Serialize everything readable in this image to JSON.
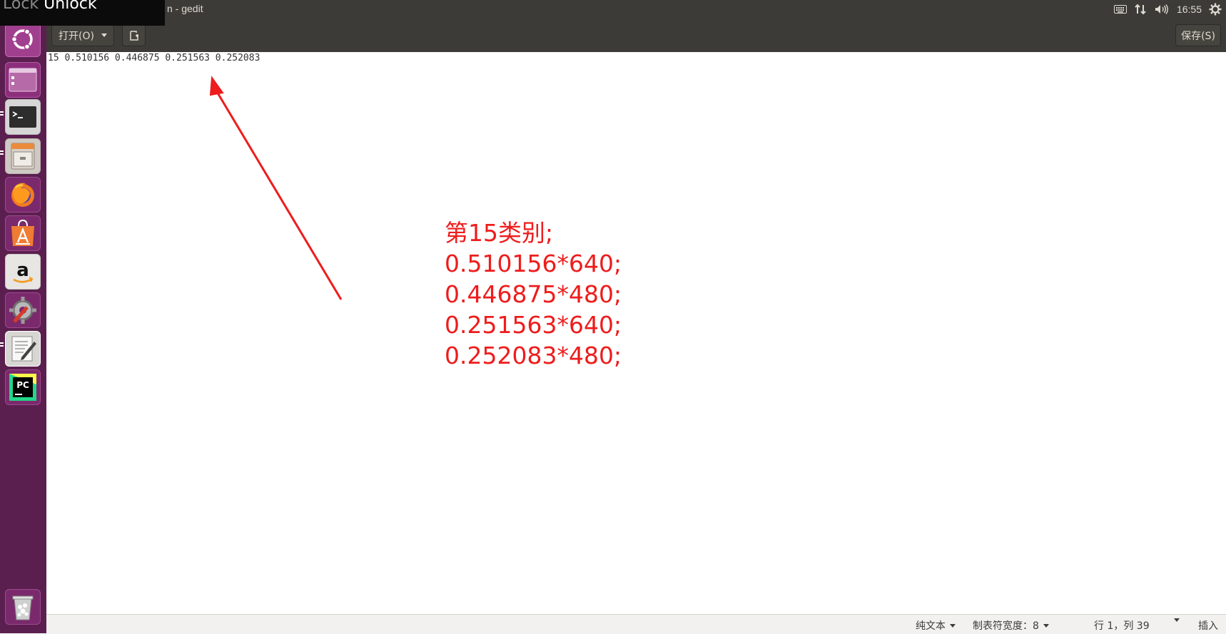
{
  "topbar": {
    "lock_text_a": "Lock",
    "lock_text_b": "Unlock",
    "window_title": "n - gedit",
    "time": "16:55"
  },
  "launcher": {
    "items": [
      {
        "name": "ubuntu-dash"
      },
      {
        "name": "workspace-switcher"
      },
      {
        "name": "terminal"
      },
      {
        "name": "files"
      },
      {
        "name": "firefox"
      },
      {
        "name": "ubuntu-software"
      },
      {
        "name": "amazon"
      },
      {
        "name": "system-settings"
      },
      {
        "name": "text-editor"
      },
      {
        "name": "pycharm",
        "label": "PC"
      },
      {
        "name": "trash"
      }
    ]
  },
  "headerbar": {
    "open_label": "打开(O)",
    "save_label": "保存(S)"
  },
  "editor": {
    "content": "15 0.510156 0.446875 0.251563 0.252083"
  },
  "annotation": {
    "lines": [
      "第15类别;",
      "0.510156*640;",
      "0.446875*480;",
      "0.251563*640;",
      "0.252083*480;"
    ],
    "color": "#ee1c1c"
  },
  "statusbar": {
    "language": "纯文本",
    "tab_width": "制表符宽度：8",
    "position": "行 1，列 39",
    "mode": "插入"
  }
}
